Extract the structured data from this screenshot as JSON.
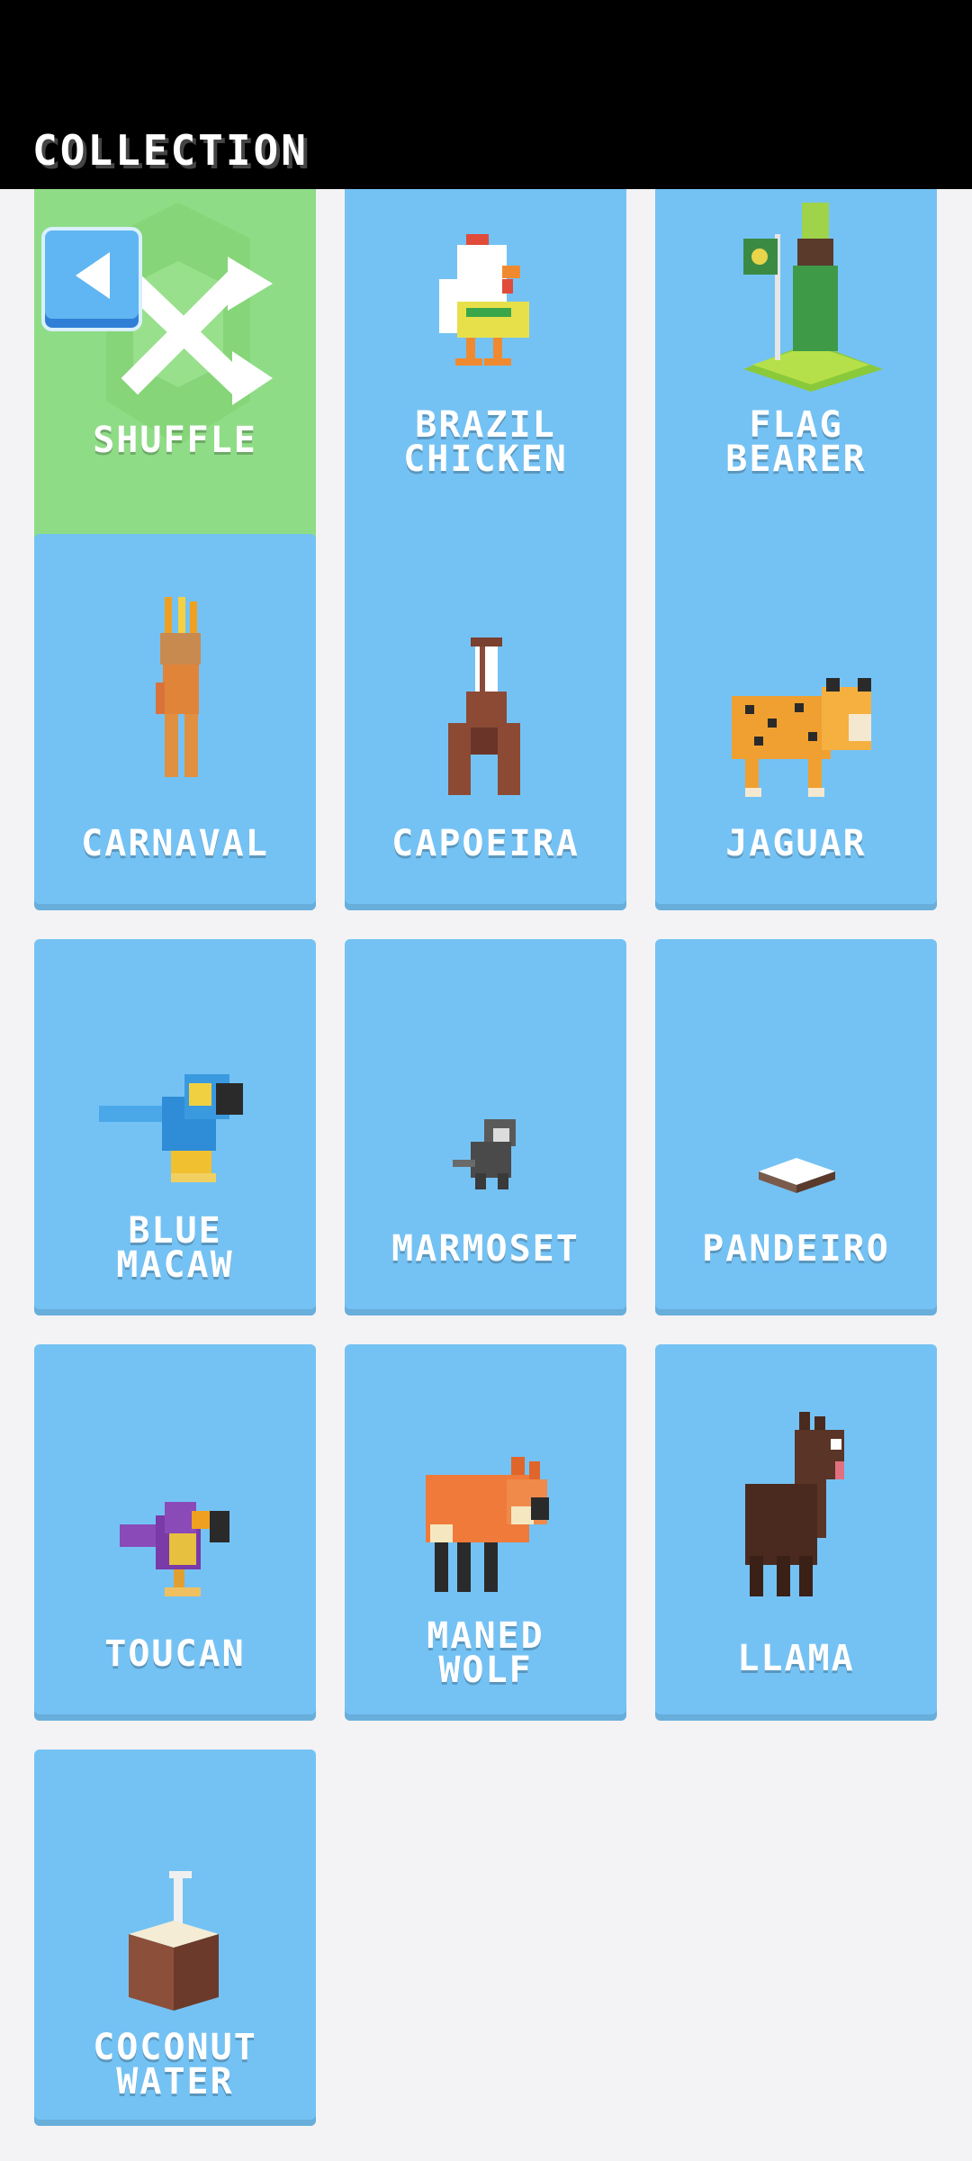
{
  "header": {
    "title": "COLLECTION"
  },
  "nav": {
    "back_icon": "back-arrow-icon"
  },
  "items": [
    {
      "label": "SHUFFLE",
      "icon": "shuffle-icon"
    },
    {
      "label": "BRAZIL\nCHICKEN",
      "icon": "chicken-icon"
    },
    {
      "label": "FLAG\nBEARER",
      "icon": "flag-bearer-icon"
    },
    {
      "label": "CARNAVAL",
      "icon": "carnaval-dancer-icon"
    },
    {
      "label": "CAPOEIRA",
      "icon": "capoeira-icon"
    },
    {
      "label": "JAGUAR",
      "icon": "jaguar-icon"
    },
    {
      "label": "BLUE\nMACAW",
      "icon": "macaw-icon"
    },
    {
      "label": "MARMOSET",
      "icon": "marmoset-icon"
    },
    {
      "label": "PANDEIRO",
      "icon": "pandeiro-icon"
    },
    {
      "label": "TOUCAN",
      "icon": "toucan-icon"
    },
    {
      "label": "MANED\nWOLF",
      "icon": "maned-wolf-icon"
    },
    {
      "label": "LLAMA",
      "icon": "llama-icon"
    },
    {
      "label": "COCONUT\nWATER",
      "icon": "coconut-water-icon"
    }
  ],
  "colors": {
    "card": "#74c2f4",
    "shuffle_card": "#8fdc86",
    "header": "#000000",
    "background": "#f3f3f5"
  }
}
